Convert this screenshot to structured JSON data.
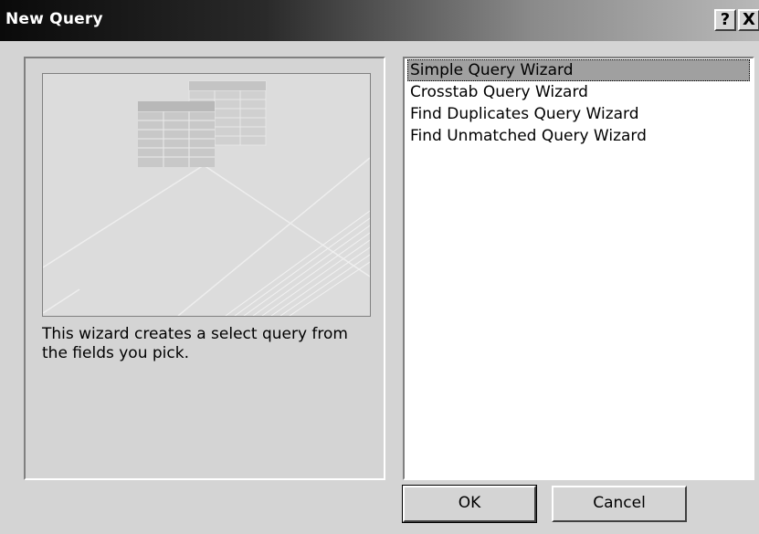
{
  "window": {
    "title": "New Query",
    "help_label": "?",
    "close_label": "X"
  },
  "preview": {
    "description": "This wizard creates a select query from the fields you pick."
  },
  "wizard_list": {
    "items": [
      "Simple Query Wizard",
      "Crosstab Query Wizard",
      "Find Duplicates Query Wizard",
      "Find Unmatched Query Wizard"
    ],
    "selected_index": 0
  },
  "buttons": {
    "ok_label": "OK",
    "cancel_label": "Cancel"
  },
  "colors": {
    "titlebar_dark": "#0a0a0a",
    "titlebar_light": "#b8b8b8",
    "dialog_face": "#d4d4d4",
    "selection": "#a0a0a0"
  }
}
